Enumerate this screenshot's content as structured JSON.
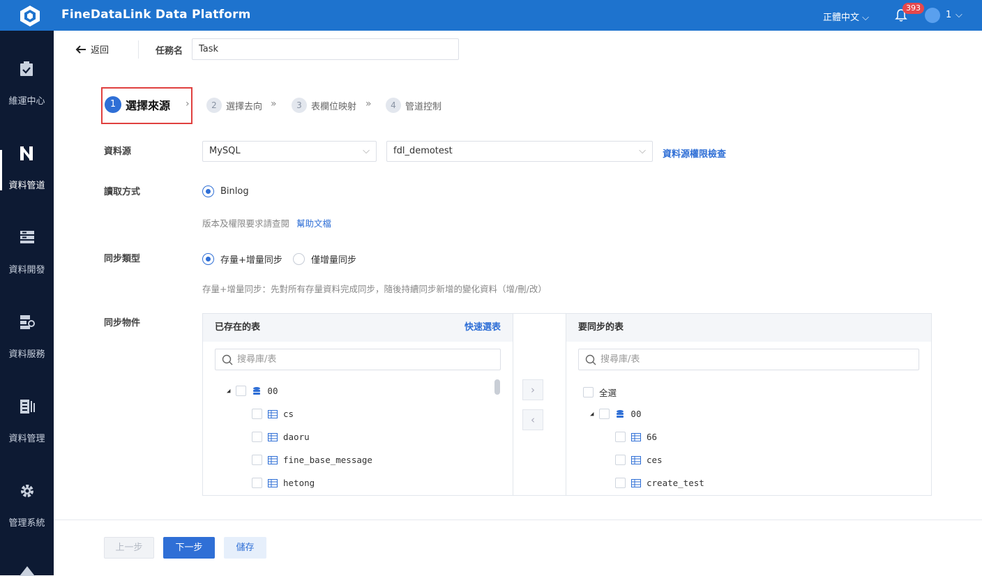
{
  "app": {
    "title": "FineDataLink Data Platform",
    "language": "正體中文",
    "notification_count": "393",
    "user_name": "1"
  },
  "sidebar": {
    "items": [
      {
        "label": "維運中心",
        "icon": "clipboard-check-icon"
      },
      {
        "label": "資料管道",
        "icon": "pipeline-icon",
        "active": true
      },
      {
        "label": "資料開發",
        "icon": "server-icon"
      },
      {
        "label": "資料服務",
        "icon": "service-icon"
      },
      {
        "label": "資料管理",
        "icon": "data-manage-icon"
      },
      {
        "label": "管理系統",
        "icon": "gear-icon"
      }
    ]
  },
  "header": {
    "back_label": "返回",
    "task_label": "任務名",
    "task_value": "Task"
  },
  "steps": [
    {
      "num": "1",
      "label": "選擇來源"
    },
    {
      "num": "2",
      "label": "選擇去向"
    },
    {
      "num": "3",
      "label": "表欄位映射"
    },
    {
      "num": "4",
      "label": "管道控制"
    }
  ],
  "form": {
    "source_label": "資料源",
    "source_type": "MySQL",
    "source_db": "fdl_demotest",
    "perm_link": "資料源權限檢查",
    "read_label": "讀取方式",
    "read_option": "Binlog",
    "version_hint": "版本及權限要求請查閱",
    "help_link": "幫助文檔",
    "sync_type_label": "同步類型",
    "sync_option_1": "存量+增量同步",
    "sync_option_2": "僅增量同步",
    "sync_hint": "存量+增量同步：先對所有存量資料完成同步，隨後持續同步新增的變化資料（增/刪/改）",
    "object_label": "同步物件"
  },
  "left_panel": {
    "title": "已存在的表",
    "quick_select": "快速選表",
    "search_placeholder": "搜尋庫/表",
    "db_name": "00",
    "tables": [
      "cs",
      "daoru",
      "fine_base_message",
      "hetong"
    ]
  },
  "right_panel": {
    "title": "要同步的表",
    "search_placeholder": "搜尋庫/表",
    "select_all": "全選",
    "db_name": "00",
    "tables": [
      "66",
      "ces",
      "create_test"
    ]
  },
  "footer": {
    "prev": "上一步",
    "next": "下一步",
    "save": "儲存"
  },
  "colors": {
    "primary": "#2f6fd6",
    "topbar": "#1e73ce",
    "sidebar": "#0d1a33",
    "highlight": "#e0403f"
  }
}
